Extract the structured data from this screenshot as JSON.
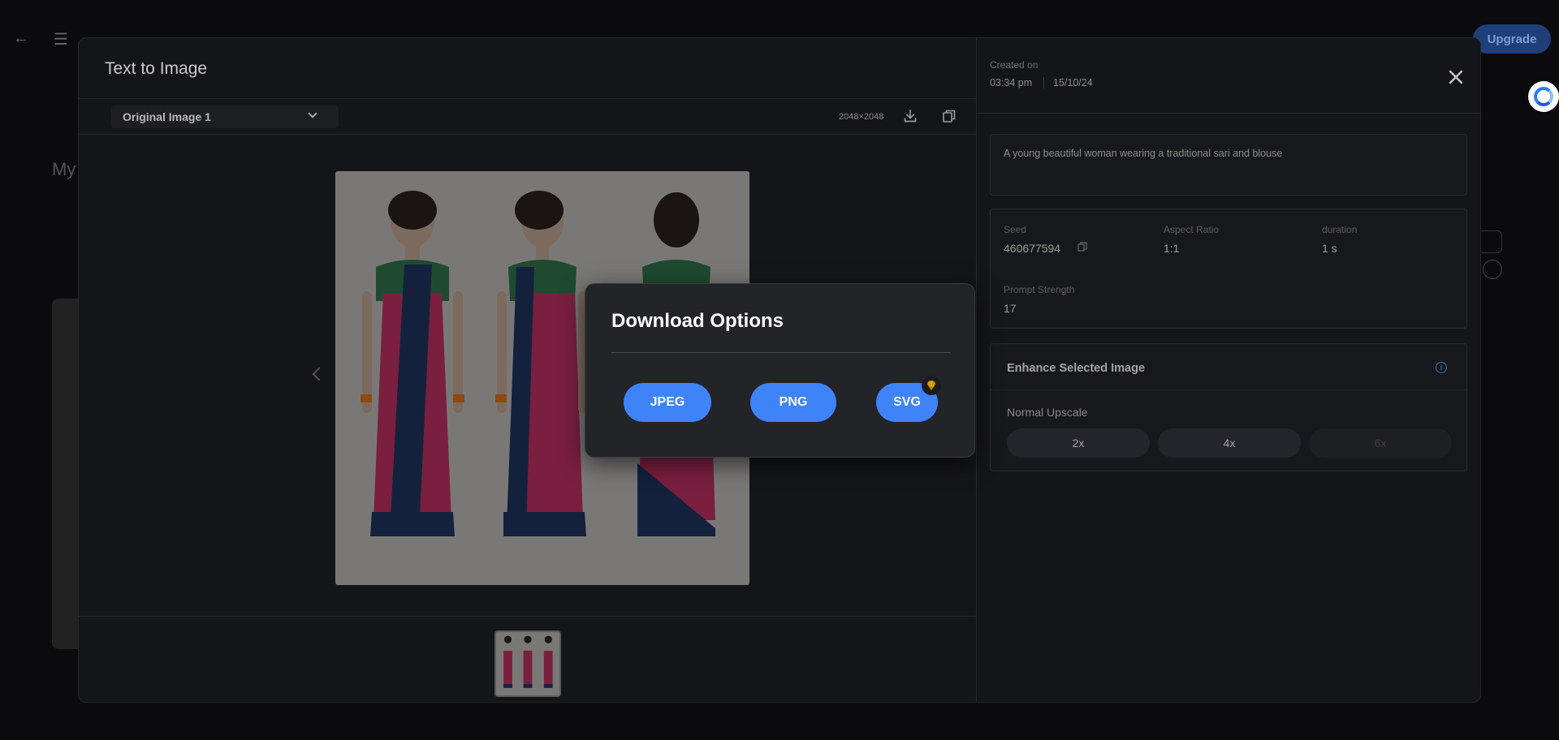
{
  "background": {
    "partial_title": "My",
    "upgrade_label": "Upgrade"
  },
  "modal": {
    "title": "Text to Image",
    "image_selector": {
      "selected": "Original Image 1"
    },
    "image_size": "2048×2048",
    "created": {
      "label": "Created on",
      "time": "03:34 pm",
      "date": "15/10/24"
    },
    "prompt": "A young beautiful woman wearing a traditional sari and blouse",
    "params": {
      "seed": {
        "label": "Seed",
        "value": "460677594"
      },
      "aspect_ratio": {
        "label": "Aspect Ratio",
        "value": "1:1"
      },
      "duration": {
        "label": "duration",
        "value": "1 s"
      },
      "prompt_strength": {
        "label": "Prompt Strength",
        "value": "17"
      }
    },
    "enhance": {
      "title": "Enhance Selected Image",
      "upscale_label": "Normal Upscale",
      "options": [
        "2x",
        "4x",
        "6x"
      ]
    }
  },
  "download_dialog": {
    "title": "Download Options",
    "formats": [
      "JPEG",
      "PNG",
      "SVG"
    ]
  },
  "colors": {
    "accent": "#3f83f8",
    "saree": "#9b1f4d",
    "border": "#0f1f3d",
    "blouse": "#1f5f3a"
  },
  "icons": [
    "back-arrow-icon",
    "menu-icon",
    "chevron-down-icon",
    "download-icon",
    "copy-icon",
    "close-icon",
    "info-icon",
    "premium-diamond-icon",
    "assistant-swirl-icon"
  ]
}
